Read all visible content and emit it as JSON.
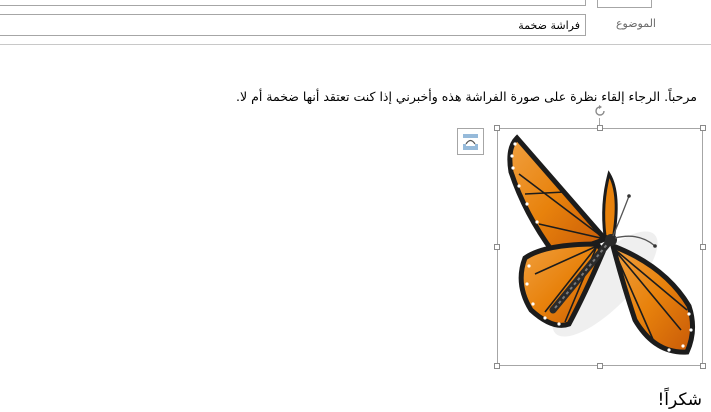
{
  "header": {
    "subject_label": "الموضوع",
    "subject_value": "فراشة ضخمة"
  },
  "message": {
    "body_text": "مرحباً. الرجاء إلقاء نظرة على صورة الفراشة هذه وأخبرني إذا كنت تعتقد أنها ضخمة أم لا.",
    "closing": "شكراً!"
  },
  "image": {
    "icon": "butterfly-image",
    "layout_icon": "layout-options-icon",
    "rotate_icon": "rotate-handle-icon",
    "colors": {
      "wing_orange": "#e8820c",
      "wing_dark": "#1c1c1c",
      "frame": "#a6a6a6"
    }
  },
  "colors": {
    "border": "#a6a6a6",
    "label": "#6b6b6b",
    "icon_blue": "#2e75b6"
  }
}
